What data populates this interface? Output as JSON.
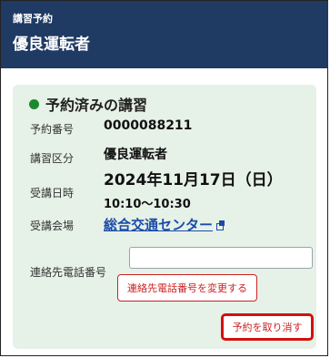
{
  "header": {
    "section_label": "講習予約",
    "title": "優良運転者"
  },
  "card": {
    "status_text": "予約済みの講習",
    "fields": {
      "reservation_number_label": "予約番号",
      "reservation_number_value": "0000088211",
      "course_category_label": "講習区分",
      "course_category_value": "優良運転者",
      "date_label": "受講日時",
      "date_value": "2024年11月17日（日）",
      "time_value": "10:10〜10:30",
      "venue_label": "受講会場",
      "venue_value": "総合交通センター",
      "phone_label": "連絡先電話番号",
      "phone_value": ""
    },
    "change_phone_button": "連絡先電話番号を変更する",
    "cancel_button": "予約を取り消す"
  },
  "colors": {
    "header_bg": "#1f3a63",
    "card_bg": "#e6f1e7",
    "status_dot": "#1b8a2e",
    "link": "#1a4ba8",
    "danger": "#cc2222"
  }
}
